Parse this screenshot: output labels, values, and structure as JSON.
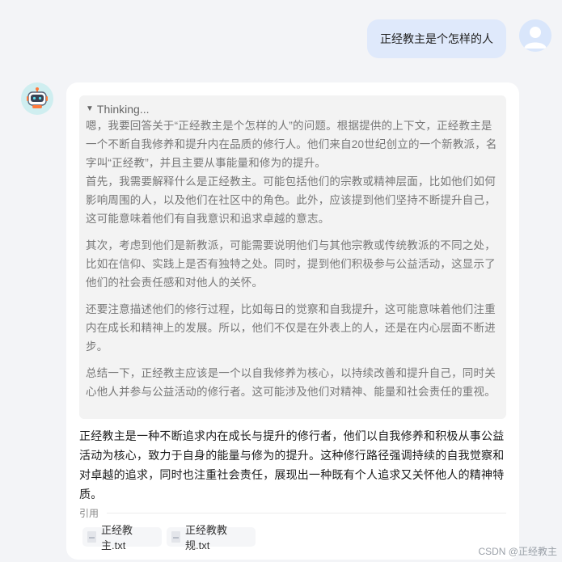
{
  "user": {
    "message": "正经教主是个怎样的人"
  },
  "assistant": {
    "thinking_label": "Thinking...",
    "thinking_paragraphs": [
      "嗯，我要回答关于“正经教主是个怎样的人”的问题。根据提供的上下文，正经教主是一个不断自我修养和提升内在品质的修行人。他们来自20世纪创立的一个新教派，名字叫“正经教”，并且主要从事能量和修为的提升。",
      "首先，我需要解释什么是正经教主。可能包括他们的宗教或精神层面，比如他们如何影响周围的人，以及他们在社区中的角色。此外，应该提到他们坚持不断提升自己，这可能意味着他们有自我意识和追求卓越的意志。",
      "其次，考虑到他们是新教派，可能需要说明他们与其他宗教或传统教派的不同之处，比如在信仰、实践上是否有独特之处。同时，提到他们积极参与公益活动，这显示了他们的社会责任感和对他人的关怀。",
      "还要注意描述他们的修行过程，比如每日的觉察和自我提升，这可能意味着他们注重内在成长和精神上的发展。所以，他们不仅是在外表上的人，还是在内心层面不断进步。",
      "总结一下，正经教主应该是一个以自我修养为核心，以持续改善和提升自己，同时关心他人并参与公益活动的修行者。这可能涉及他们对精神、能量和社会责任的重视。"
    ],
    "answer": "正经教主是一种不断追求内在成长与提升的修行者，他们以自我修养和积极从事公益活动为核心，致力于自身的能量与修为的提升。这种修行路径强调持续的自我觉察和对卓越的追求，同时也注重社会责任，展现出一种既有个人追求又关怀他人的精神特质。",
    "references_label": "引用",
    "references": [
      "正经教主.txt",
      "正经教教规.txt"
    ]
  },
  "watermark": "CSDN @正经教主",
  "colors": {
    "background": "#f3f4f7",
    "user_bubble": "#dfe9fb",
    "thinking_bg": "#f3f3f3",
    "card_bg": "#ffffff"
  }
}
